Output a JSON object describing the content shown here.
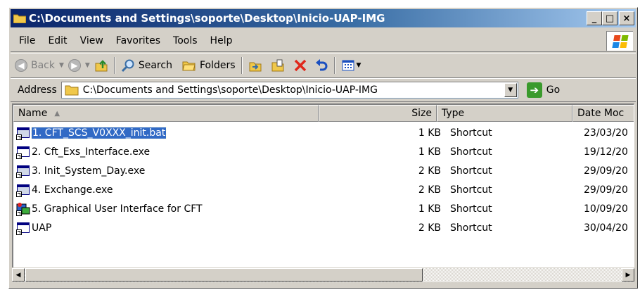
{
  "window": {
    "title": "C:\\Documents and Settings\\soporte\\Desktop\\Inicio-UAP-IMG",
    "minimize_label": "_",
    "maximize_label": "□",
    "close_label": "×"
  },
  "menu": {
    "items": [
      "File",
      "Edit",
      "View",
      "Favorites",
      "Tools",
      "Help"
    ]
  },
  "toolbar": {
    "back_label": "Back",
    "search_label": "Search",
    "folders_label": "Folders"
  },
  "address": {
    "label": "Address",
    "value": "C:\\Documents and Settings\\soporte\\Desktop\\Inicio-UAP-IMG",
    "go_label": "Go"
  },
  "list": {
    "columns": [
      "Name",
      "Size",
      "Type",
      "Date Moc"
    ],
    "rows": [
      {
        "name": "1. CFT_SCS_V0XXX_init.bat",
        "size": "1 KB",
        "type": "Shortcut",
        "date": "23/03/20",
        "icon": "batch-shortcut-icon",
        "selected": true
      },
      {
        "name": "2. Cft_Exs_Interface.exe",
        "size": "1 KB",
        "type": "Shortcut",
        "date": "19/12/20",
        "icon": "exe-shortcut-icon"
      },
      {
        "name": "3. Init_System_Day.exe",
        "size": "2 KB",
        "type": "Shortcut",
        "date": "29/09/20",
        "icon": "batch-shortcut-icon"
      },
      {
        "name": "4. Exchange.exe",
        "size": "2 KB",
        "type": "Shortcut",
        "date": "29/09/20",
        "icon": "batch-shortcut-icon"
      },
      {
        "name": "5. Graphical User Interface for CFT",
        "size": "1 KB",
        "type": "Shortcut",
        "date": "10/09/20",
        "icon": "app-shortcut-icon"
      },
      {
        "name": "UAP",
        "size": "2 KB",
        "type": "Shortcut",
        "date": "30/04/20",
        "icon": "exe-shortcut-icon"
      }
    ]
  },
  "colors": {
    "title_start": "#0a246a",
    "title_end": "#a6caf0",
    "selection": "#316ac5",
    "face": "#d4d0c8"
  }
}
